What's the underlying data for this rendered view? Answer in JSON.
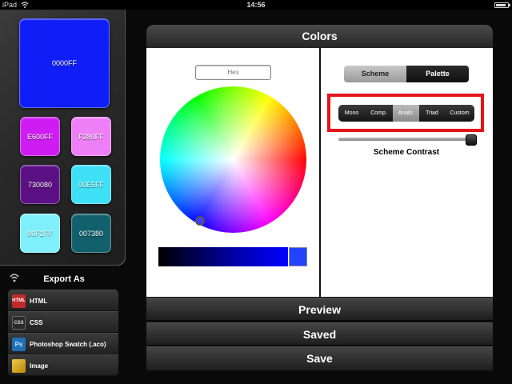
{
  "status_bar": {
    "carrier": "iPad",
    "time": "14:56",
    "wifi_icon": "wifi-icon",
    "battery_icon": "battery-icon"
  },
  "swatches": [
    {
      "label": "0000FF",
      "color": "#0f1ef7"
    },
    {
      "label": "E600FF",
      "color": "#ce1cf2"
    },
    {
      "label": "F280FF",
      "color": "#ef7ff6"
    },
    {
      "label": "730080",
      "color": "#5a0f82"
    },
    {
      "label": "00E5FF",
      "color": "#3ee0f6"
    },
    {
      "label": "80F2FF",
      "color": "#7ff0fb"
    },
    {
      "label": "007380",
      "color": "#11606b"
    }
  ],
  "export": {
    "title": "Export As",
    "items": [
      {
        "label": "HTML",
        "icon": "html-icon",
        "icon_text": "HTML"
      },
      {
        "label": "CSS",
        "icon": "css-icon",
        "icon_text": "CSS"
      },
      {
        "label": "Photoshop Swatch (.aco)",
        "icon": "photoshop-icon",
        "icon_text": "Ps"
      },
      {
        "label": "Image",
        "icon": "image-icon",
        "icon_text": ""
      }
    ]
  },
  "main": {
    "title": "Colors",
    "hex_placeholder": "Hex",
    "tabs": [
      {
        "label": "Scheme",
        "selected": true
      },
      {
        "label": "Palette",
        "selected": false
      }
    ],
    "scheme_modes": [
      {
        "label": "Mono",
        "selected": false
      },
      {
        "label": "Comp.",
        "selected": false
      },
      {
        "label": "Analo.",
        "selected": true
      },
      {
        "label": "Triad",
        "selected": false
      },
      {
        "label": "Custom",
        "selected": false
      }
    ],
    "contrast_label": "Scheme Contrast",
    "contrast_value": 1.0
  },
  "bottom": {
    "preview": "Preview",
    "saved": "Saved",
    "save": "Save"
  },
  "colors": {
    "highlight": "#e3141c",
    "selected_color": "#0000FF"
  }
}
